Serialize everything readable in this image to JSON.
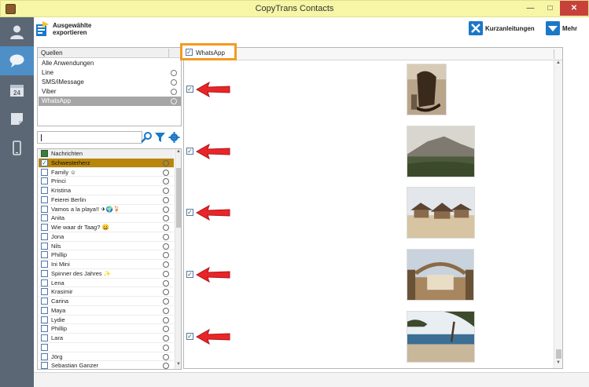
{
  "window": {
    "title": "CopyTrans Contacts",
    "minimize_glyph": "—",
    "maximize_glyph": "□",
    "close_glyph": "✕"
  },
  "toolbar": {
    "export_label": "Ausgewählte exportieren",
    "guides_label": "Kurzanleitungen",
    "more_label": "Mehr"
  },
  "sources": {
    "header": "Quellen",
    "items": [
      {
        "label": "Alle Anwendungen",
        "icon": ""
      },
      {
        "label": "Line",
        "icon": "line-icon"
      },
      {
        "label": "SMS/iMessage",
        "icon": "sms-icon"
      },
      {
        "label": "Viber",
        "icon": "viber-icon"
      },
      {
        "label": "WhatsApp",
        "icon": "whatsapp-icon",
        "selected": true
      }
    ]
  },
  "search": {
    "value": ""
  },
  "contacts": {
    "header": "Nachrichten",
    "items": [
      {
        "name": "Schwesterherz",
        "checked": true,
        "selected": true
      },
      {
        "name": "Family ☺",
        "checked": false
      },
      {
        "name": "Princi",
        "checked": false
      },
      {
        "name": "Kristina",
        "checked": false
      },
      {
        "name": "Feierei Berlin",
        "checked": false
      },
      {
        "name": "Vamos a la playa!! ✈🌍🍹",
        "checked": false
      },
      {
        "name": "Anita",
        "checked": false
      },
      {
        "name": "Wie waar dr Taag? 😀",
        "checked": false
      },
      {
        "name": "Jona",
        "checked": false
      },
      {
        "name": "Nils",
        "checked": false
      },
      {
        "name": "Phillip",
        "checked": false
      },
      {
        "name": "Ini Mini",
        "checked": false
      },
      {
        "name": "Spinner des Jahres ✨",
        "checked": false
      },
      {
        "name": "Lena",
        "checked": false
      },
      {
        "name": "Krasimir",
        "checked": false
      },
      {
        "name": "Carina",
        "checked": false
      },
      {
        "name": "Maya",
        "checked": false
      },
      {
        "name": "Lydie",
        "checked": false
      },
      {
        "name": "Phillip",
        "checked": false
      },
      {
        "name": "Lara",
        "checked": false
      },
      {
        "name": "",
        "checked": false
      },
      {
        "name": "Jörg",
        "checked": false
      },
      {
        "name": "Sebastian Ganzer",
        "checked": false
      }
    ]
  },
  "messages": {
    "header_label": "WhatsApp",
    "header_checked": true,
    "items": [
      {
        "checked": true,
        "photo": "rocking-chair"
      },
      {
        "checked": true,
        "photo": "mountain-landscape"
      },
      {
        "checked": true,
        "photo": "beach-huts"
      },
      {
        "checked": true,
        "photo": "thatched-pavilion"
      },
      {
        "checked": true,
        "photo": "beach-sea"
      }
    ]
  },
  "colors": {
    "accent_blue": "#1b78c7",
    "highlight_orange": "#f39a23",
    "arrow_red": "#e8262a",
    "selected_contact": "#b8860b",
    "rail_bg": "#5b6775",
    "rail_active": "#4e8fc7"
  }
}
